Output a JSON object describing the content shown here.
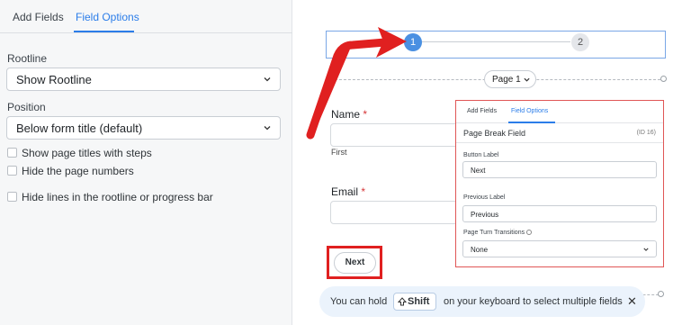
{
  "left_panel": {
    "tabs": [
      {
        "label": "Add Fields"
      },
      {
        "label": "Field Options"
      }
    ],
    "rootline": {
      "label": "Rootline",
      "value": "Show Rootline"
    },
    "position": {
      "label": "Position",
      "value": "Below form title (default)"
    },
    "checkboxes": [
      {
        "label": "Show page titles with steps",
        "checked": false
      },
      {
        "label": "Hide the page numbers",
        "checked": false
      },
      {
        "label": "Hide lines in the rootline or progress bar",
        "checked": false
      }
    ]
  },
  "canvas": {
    "steps": [
      "1",
      "2"
    ],
    "page_dropdown": "Page 1",
    "name_field": {
      "label": "Name",
      "required_mark": "*",
      "sublabel": "First"
    },
    "email_field": {
      "label": "Email",
      "required_mark": "*"
    },
    "next_button": "Next"
  },
  "options_card": {
    "tabs": [
      {
        "label": "Add Fields"
      },
      {
        "label": "Field Options"
      }
    ],
    "title": "Page Break Field",
    "id_text": "(ID 16)",
    "button_label": {
      "label": "Button Label",
      "value": "Next"
    },
    "previous_label": {
      "label": "Previous Label",
      "value": "Previous"
    },
    "transitions": {
      "label": "Page Turn Transitions",
      "value": "None"
    }
  },
  "toast": {
    "text_before": "You can hold",
    "key": "Shift",
    "text_after": "on your keyboard to select multiple fields",
    "close": "✕"
  },
  "colors": {
    "accent": "#2b7de9",
    "annotation_red": "#e02020",
    "toast_bg": "#ebf3fc"
  }
}
